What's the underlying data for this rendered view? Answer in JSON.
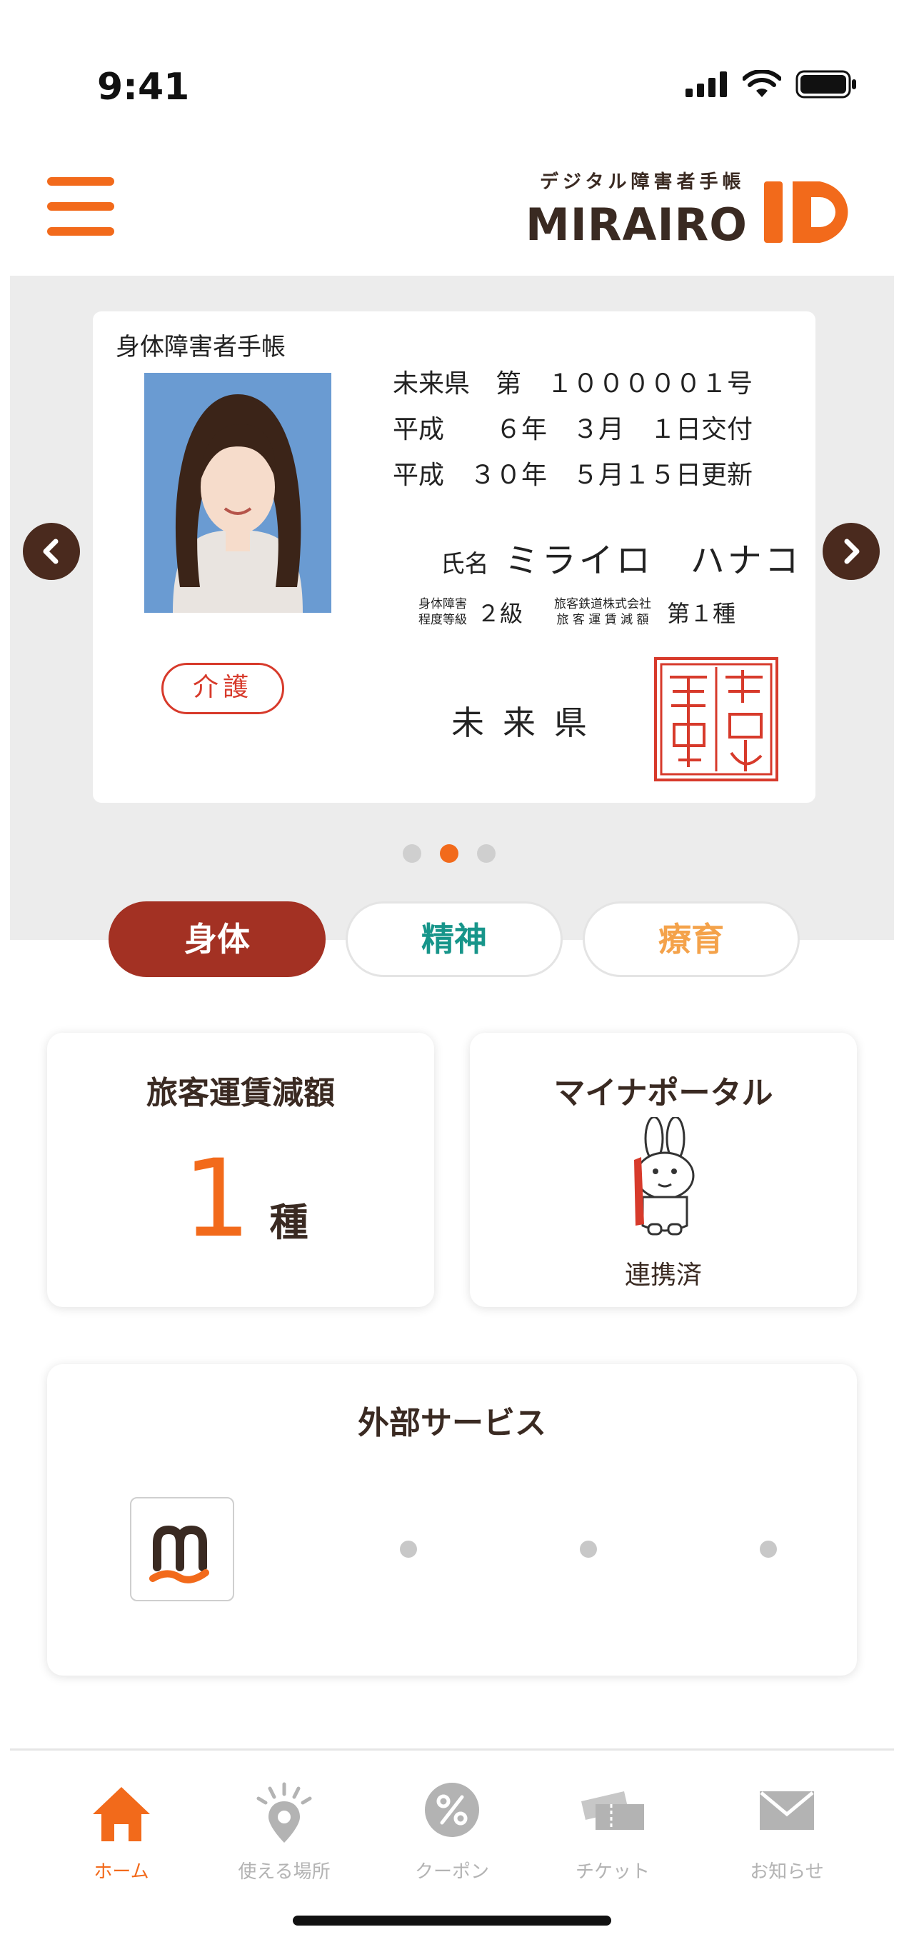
{
  "status_bar": {
    "time": "9:41"
  },
  "header": {
    "tagline": "デジタル障害者手帳",
    "brand": "MIRAIRO",
    "brand_id": "ID"
  },
  "card": {
    "type_label": "身体障害者手帳",
    "lines": [
      "未来県　第　１０００００１号",
      "平成　　６年　３月　１日交付",
      "平成　３０年　５月１５日更新"
    ],
    "name_label": "氏名",
    "name_value": "ミライロ　ハナコ",
    "grade_label_1": "身体障害",
    "grade_label_2": "程度等級",
    "grade_value": "２級",
    "rail_label_1": "旅客鉄道株式会社",
    "rail_label_2": "旅 客 運 賃 減 額",
    "rail_value": "第１種",
    "badge": "介護",
    "issuer": "未来県",
    "seal_text": "障害者手帳"
  },
  "carousel": {
    "dots": 3,
    "active_index": 1
  },
  "category_tabs": [
    {
      "label": "身体",
      "active": true
    },
    {
      "label": "精神",
      "active": false
    },
    {
      "label": "療育",
      "active": false
    }
  ],
  "fare_card": {
    "title": "旅客運賃減額",
    "value": "1",
    "unit": "種"
  },
  "portal_card": {
    "title": "マイナポータル",
    "status": "連携済"
  },
  "external": {
    "title": "外部サービス"
  },
  "tabbar": {
    "items": [
      {
        "label": "ホーム",
        "icon": "home-icon",
        "active": true
      },
      {
        "label": "使える場所",
        "icon": "location-pin-icon",
        "active": false
      },
      {
        "label": "クーポン",
        "icon": "percent-coupon-icon",
        "active": false
      },
      {
        "label": "チケット",
        "icon": "ticket-icon",
        "active": false
      },
      {
        "label": "お知らせ",
        "icon": "mail-icon",
        "active": false
      }
    ]
  },
  "colors": {
    "accent": "#f26a1b",
    "brown": "#3a2a22",
    "physical": "#a33123",
    "mental": "#17958a",
    "rehab": "#f4a24a"
  }
}
